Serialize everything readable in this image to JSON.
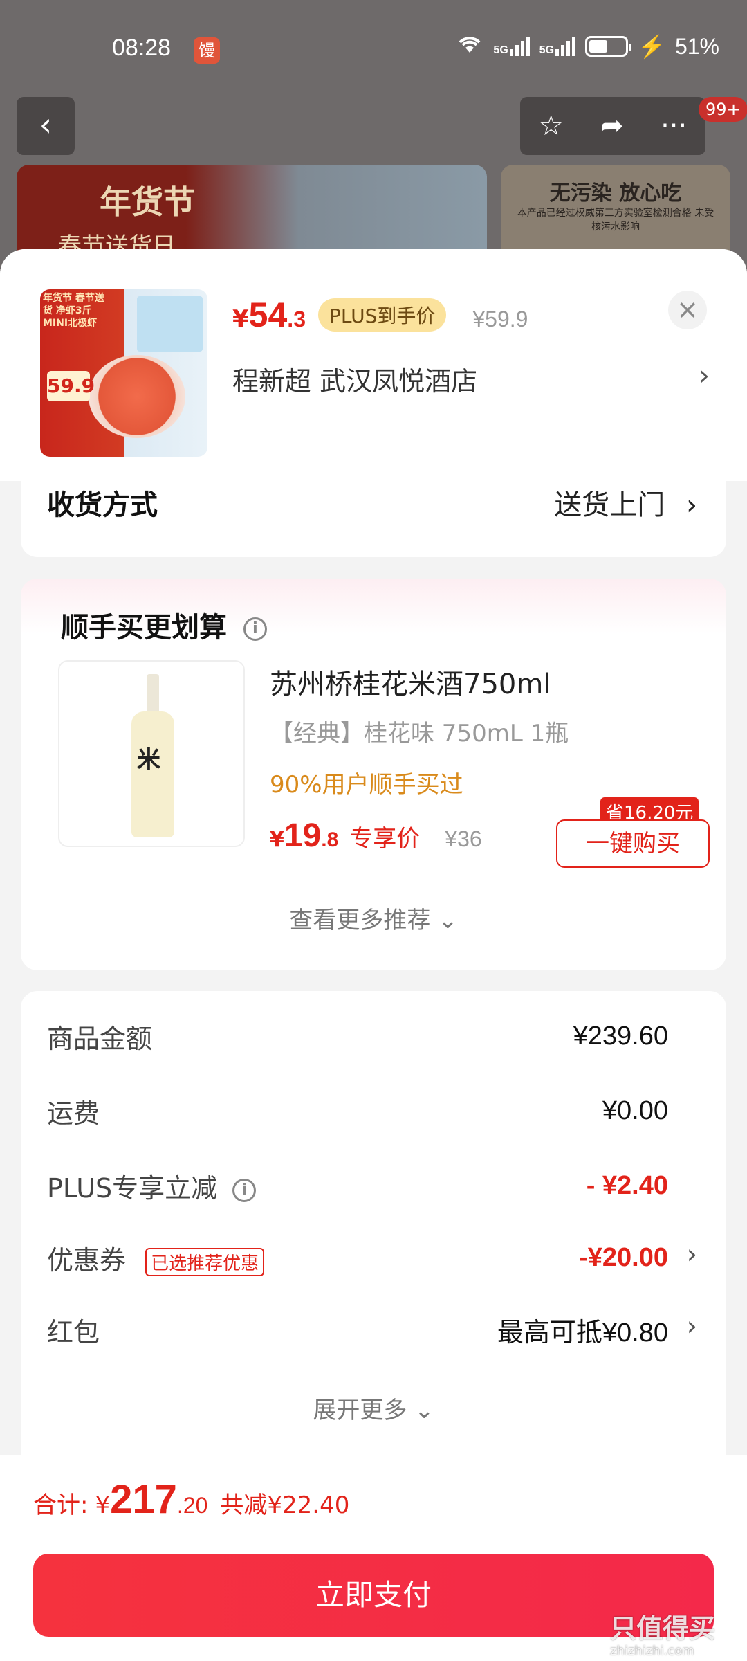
{
  "status_bar": {
    "time": "08:28",
    "notify_icon_text": "馒",
    "signal_1": "5G",
    "signal_2": "5G",
    "battery": "51%"
  },
  "top_nav": {
    "badge": "99+"
  },
  "banner": {
    "left_title": "年货节",
    "left_sub": "春节送货日",
    "right_title": "无污染 放心吃",
    "right_sub": "本产品已经过权威第三方实验室检测合格 未受核污水影响"
  },
  "product": {
    "thumb_label": "年货节 春节送货 净虾3斤 MINI北极虾",
    "thumb_price": "59.9",
    "price_symbol": "¥",
    "price_int": "54",
    "price_dec": ".3",
    "plus_tag": "PLUS到手价",
    "orig_price": "¥59.9",
    "address": "程新超  武汉凤悦酒店"
  },
  "shipping": {
    "label": "收货方式",
    "value": "送货上门"
  },
  "recommend": {
    "title": "顺手买更划算",
    "bottle_label": "米",
    "name": "苏州桥桂花米酒750ml",
    "spec": "【经典】桂花味 750mL 1瓶",
    "buyers": "90%用户顺手买过",
    "price_symbol": "¥",
    "price_int": "19",
    "price_dec": ".8",
    "price_label": "专享价",
    "orig_price": "¥36",
    "save_badge": "省16.20元",
    "buy_button": "一键购买",
    "more": "查看更多推荐"
  },
  "summary": {
    "goods_label": "商品金额",
    "goods_value": "¥239.60",
    "freight_label": "运费",
    "freight_value": "¥0.00",
    "plus_label": "PLUS专享立减",
    "plus_value": "- ¥2.40",
    "coupon_label": "优惠券",
    "coupon_tag": "已选推荐优惠",
    "coupon_value": "-¥20.00",
    "redpacket_label": "红包",
    "redpacket_value": "最高可抵¥0.80",
    "expand": "展开更多"
  },
  "footer": {
    "total_label": "合计:",
    "total_symbol": "¥",
    "total_int": "217",
    "total_dec": ".20",
    "total_saved": "共减¥22.40",
    "pay_button": "立即支付"
  },
  "watermark": {
    "main": "只值得买",
    "sub": "zhizhizhi.com"
  },
  "colors": {
    "accent_red": "#e2231a",
    "plus_gold": "#fbe29c",
    "buyers_orange": "#d98a1b",
    "pay_button": "#f5323e"
  }
}
